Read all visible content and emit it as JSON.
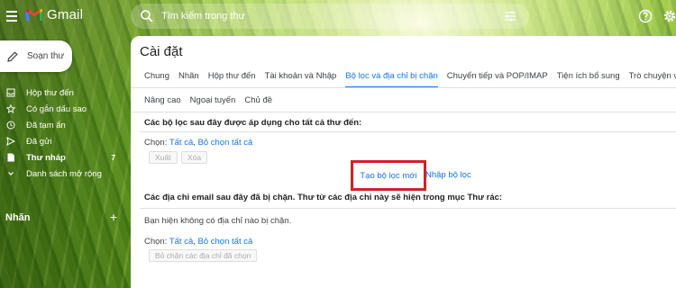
{
  "app": {
    "logo_text": "Gmail"
  },
  "search": {
    "placeholder": "Tìm kiếm trong thư"
  },
  "sidebar": {
    "compose_label": "Soạn thư",
    "items": [
      {
        "label": "Hộp thư đến",
        "icon": "inbox-icon"
      },
      {
        "label": "Có gắn dấu sao",
        "icon": "star-icon"
      },
      {
        "label": "Đã tạm ẩn",
        "icon": "clock-icon"
      },
      {
        "label": "Đã gửi",
        "icon": "send-icon"
      },
      {
        "label": "Thư nháp",
        "icon": "draft-icon",
        "count": "7"
      },
      {
        "label": "Danh sách mở rộng",
        "icon": "chevron-down-icon"
      }
    ],
    "labels_heading": "Nhãn",
    "labels_add": "+"
  },
  "settings": {
    "title": "Cài đặt",
    "tabs": [
      "Chung",
      "Nhãn",
      "Hộp thư đến",
      "Tài khoản và Nhập",
      "Bộ lọc và địa chỉ bị chặn",
      "Chuyển tiếp và POP/IMAP",
      "Tiện ích bổ sung",
      "Trò chuyện và Meet"
    ],
    "tabs_row2": [
      "Nâng cao",
      "Ngoại tuyến",
      "Chủ đề"
    ],
    "active_tab": "Bộ lọc và địa chỉ bị chặn",
    "filters": {
      "heading": "Các bộ lọc sau đây được áp dụng cho tất cả thư đến:",
      "select_prefix": "Chọn: ",
      "select_all": "Tất cả",
      "select_none": "Bỏ chọn tất cả",
      "export_label": "Xuất",
      "delete_label": "Xóa",
      "create_label": "Tạo bộ lọc mới",
      "import_label": "Nhập bộ lọc"
    },
    "blocked": {
      "heading": "Các địa chỉ email sau đây đã bị chặn. Thư từ các địa chỉ này sẽ hiện trong mục Thư rác:",
      "empty_note": "Bạn hiện không có địa chỉ nào bị chặn.",
      "select_prefix": "Chọn: ",
      "select_all": "Tất cả",
      "select_none": "Bỏ chọn tất cả",
      "unblock_label": "Bỏ chặn các địa chỉ đã chọn"
    }
  },
  "colors": {
    "accent": "#1a73e8",
    "highlight_box": "#d32027"
  }
}
